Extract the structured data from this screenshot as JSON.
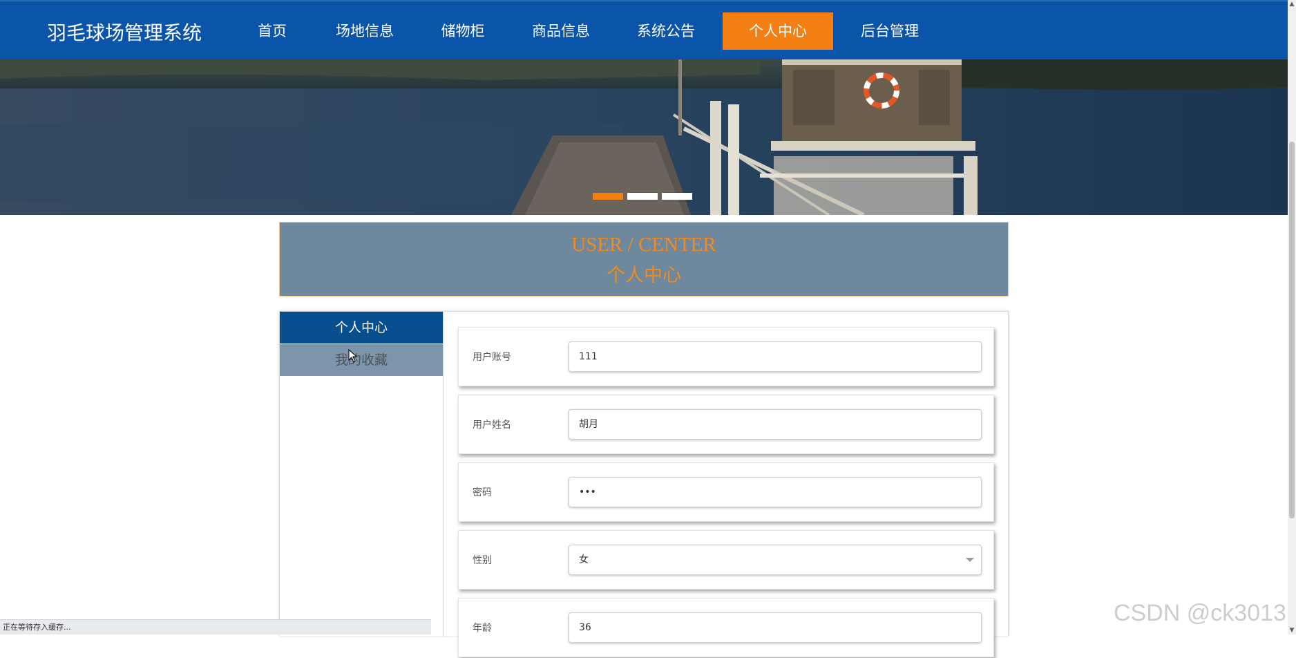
{
  "brand": "羽毛球场管理系统",
  "nav": {
    "items": [
      {
        "label": "首页",
        "active": false
      },
      {
        "label": "场地信息",
        "active": false
      },
      {
        "label": "储物柜",
        "active": false
      },
      {
        "label": "商品信息",
        "active": false
      },
      {
        "label": "系统公告",
        "active": false
      },
      {
        "label": "个人中心",
        "active": true
      },
      {
        "label": "后台管理",
        "active": false
      }
    ]
  },
  "banner": {
    "slides": 3,
    "active_slide": 1,
    "indicator_color": "#f47f12"
  },
  "center": {
    "title_en": "USER / CENTER",
    "title_cn": "个人中心"
  },
  "sidebar": {
    "items": [
      {
        "label": "个人中心",
        "active": true
      },
      {
        "label": "我的收藏",
        "active": false
      }
    ]
  },
  "form": {
    "fields": [
      {
        "label": "用户账号",
        "value": "111"
      },
      {
        "label": "用户姓名",
        "value": "胡月"
      },
      {
        "label": "密码",
        "value": "•••"
      },
      {
        "label": "性别",
        "value": "女"
      },
      {
        "label": "年龄",
        "value": "36"
      }
    ]
  },
  "status_bar": "正在等待存入缓存...",
  "watermark": "CSDN @ck3013",
  "colors": {
    "nav_bg": "#0a55a9",
    "accent": "#f47f12",
    "title_box_bg": "#6e889e",
    "sidebar_active": "#074f8e",
    "sidebar_inactive": "#7d95ab"
  }
}
